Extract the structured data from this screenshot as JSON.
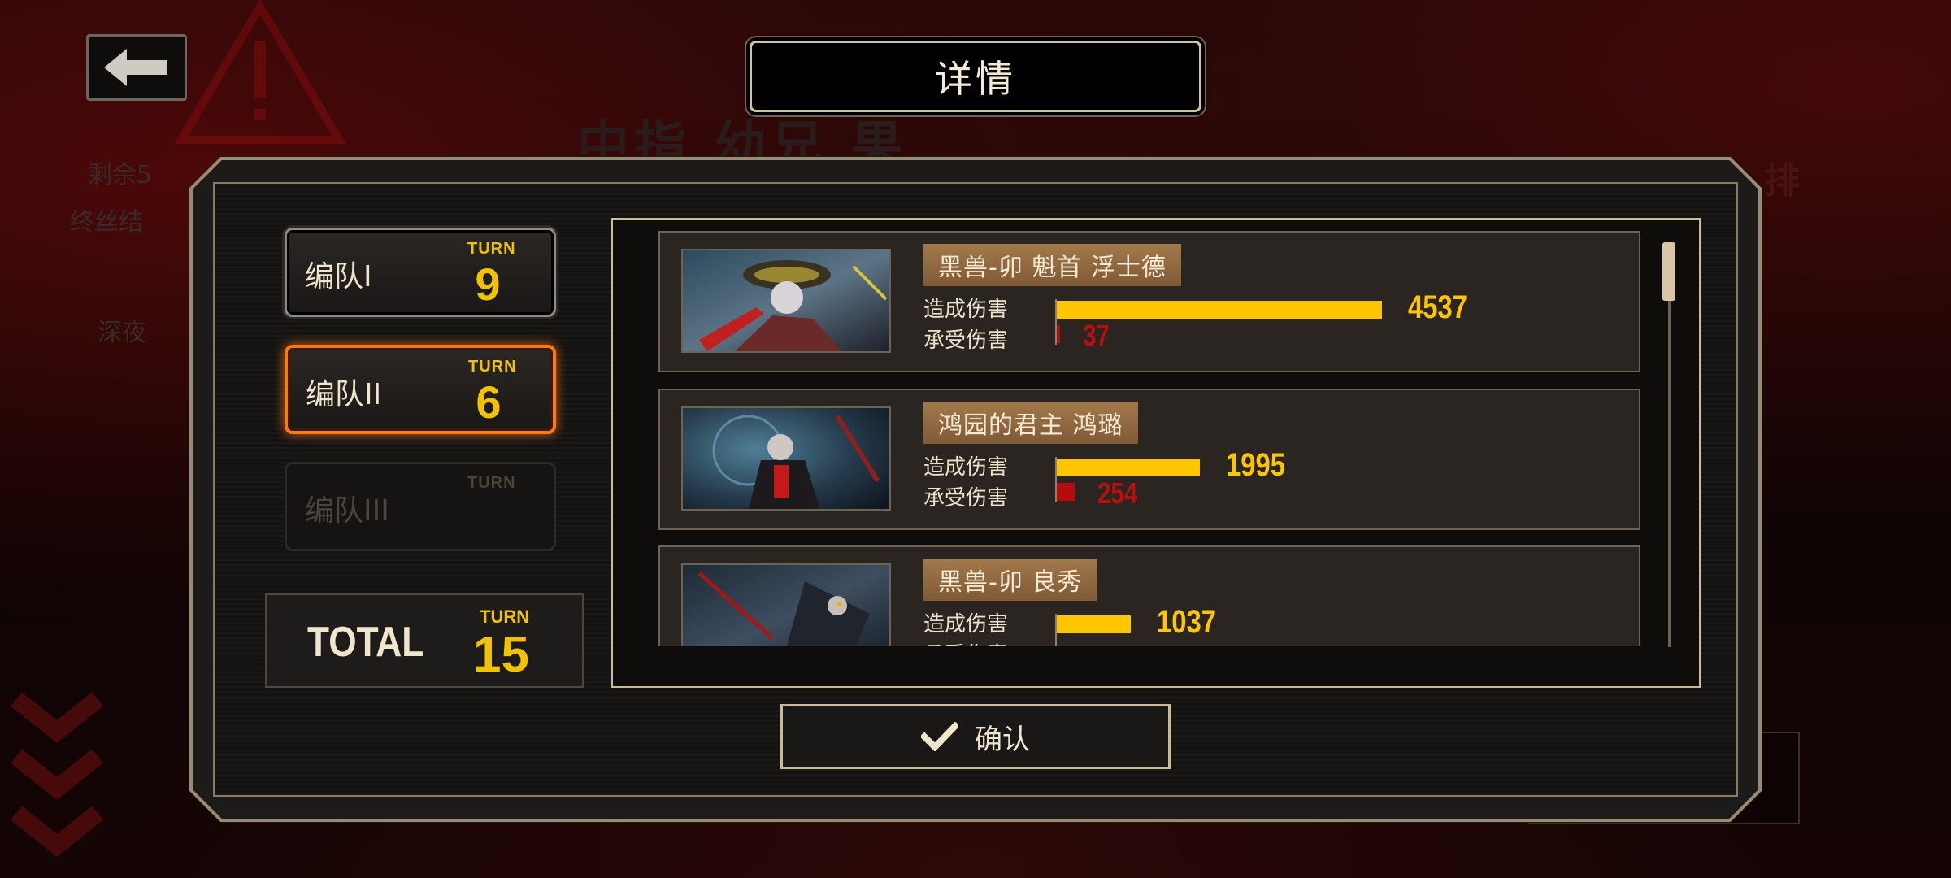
{
  "screen": {
    "title": "详情",
    "back_icon": "arrow-left-icon"
  },
  "background": {
    "title_text": "中指 幼兄 果",
    "left_text_1": "剩余5",
    "left_text_2": "终丝结",
    "left_text_3": "深夜",
    "right_text": "排"
  },
  "teams": [
    {
      "label": "编队I",
      "turn_label": "TURN",
      "turn": "9",
      "state": "normal"
    },
    {
      "label": "编队II",
      "turn_label": "TURN",
      "turn": "6",
      "state": "selected"
    },
    {
      "label": "编队III",
      "turn_label": "TURN",
      "turn": "",
      "state": "disabled"
    }
  ],
  "total": {
    "label": "TOTAL",
    "turn_label": "TURN",
    "turn": "15"
  },
  "characters": [
    {
      "name": "黑兽-卯 魁首 浮士德",
      "dealt_label": "造成伤害",
      "taken_label": "承受伤害",
      "dealt": "4537",
      "taken": "37"
    },
    {
      "name": "鸿园的君主 鸿璐",
      "dealt_label": "造成伤害",
      "taken_label": "承受伤害",
      "dealt": "1995",
      "taken": "254"
    },
    {
      "name": "黑兽-卯 良秀",
      "dealt_label": "造成伤害",
      "taken_label": "承受伤害",
      "dealt": "1037",
      "taken": ""
    }
  ],
  "confirm": {
    "label": "确认",
    "icon": "check-icon"
  },
  "colors": {
    "accent_selected": "#ff7a10",
    "turn_yellow": "#f2c200",
    "dealt_bar": "#ffc500",
    "taken_bar": "#b50d0d",
    "frame_gold": "#cdbb96"
  }
}
